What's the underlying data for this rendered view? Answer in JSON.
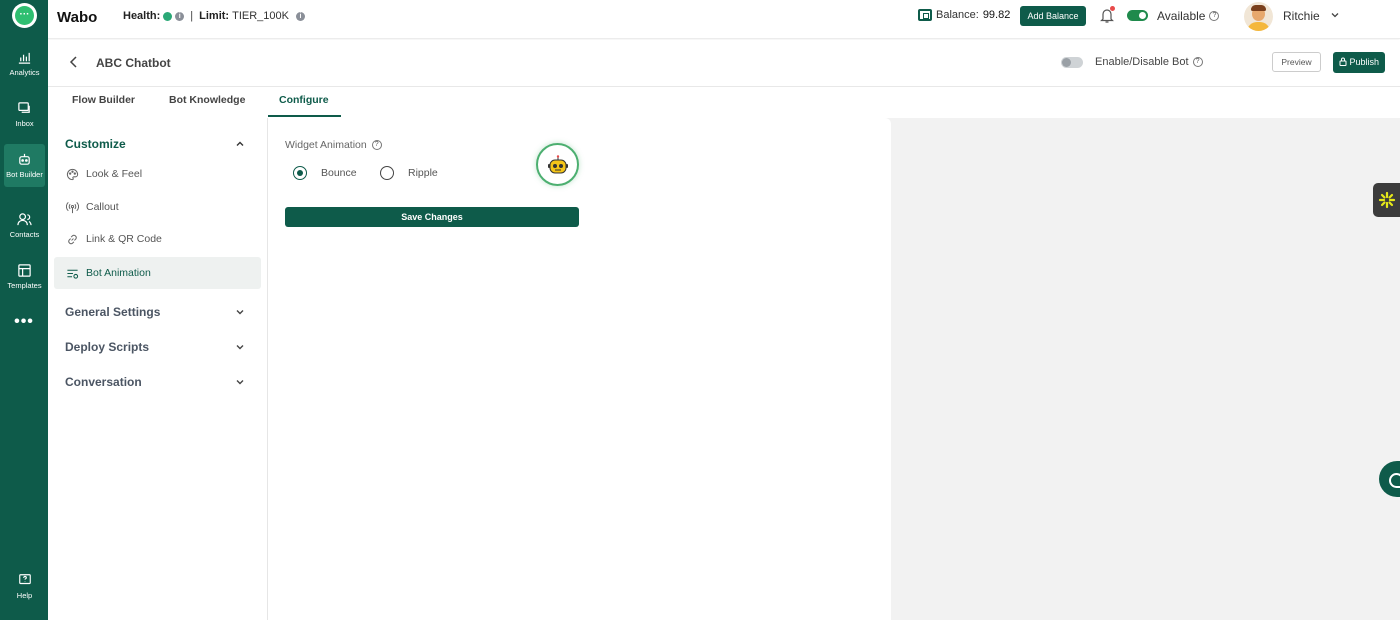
{
  "app": {
    "brand": "Wabo",
    "health_label": "Health:",
    "limit_label": "Limit:",
    "limit_value": "TIER_100K",
    "balance_label": "Balance:",
    "balance_value": "99.82",
    "add_balance": "Add Balance",
    "status": "Available",
    "user_name": "Ritchie",
    "colors": {
      "brand": "#0e5b4a",
      "health": "#2aa876",
      "notification": "#e84a4a"
    }
  },
  "rail": {
    "items": [
      {
        "label": "Analytics",
        "icon": "analytics-icon"
      },
      {
        "label": "Inbox",
        "icon": "inbox-icon"
      },
      {
        "label": "Bot Builder",
        "icon": "bot-icon"
      },
      {
        "label": "Contacts",
        "icon": "contacts-icon"
      },
      {
        "label": "Templates",
        "icon": "templates-icon"
      }
    ],
    "more": "•••",
    "help": "Help"
  },
  "header": {
    "bot_name": "ABC Chatbot",
    "enable_label": "Enable/Disable Bot",
    "preview": "Preview",
    "publish": "Publish"
  },
  "tabs": [
    {
      "label": "Flow Builder",
      "active": false
    },
    {
      "label": "Bot Knowledge",
      "active": false
    },
    {
      "label": "Configure",
      "active": true
    }
  ],
  "sidebar": {
    "customize": "Customize",
    "items": [
      {
        "label": "Look & Feel",
        "icon": "palette-icon"
      },
      {
        "label": "Callout",
        "icon": "broadcast-icon"
      },
      {
        "label": "Link & QR Code",
        "icon": "link-icon"
      },
      {
        "label": "Bot Animation",
        "icon": "animation-settings-icon",
        "active": true
      }
    ],
    "sections": [
      {
        "label": "General Settings"
      },
      {
        "label": "Deploy Scripts"
      },
      {
        "label": "Conversation"
      }
    ]
  },
  "widget": {
    "title": "Widget Animation",
    "options": [
      {
        "label": "Bounce",
        "selected": true
      },
      {
        "label": "Ripple",
        "selected": false
      }
    ],
    "save": "Save Changes"
  }
}
